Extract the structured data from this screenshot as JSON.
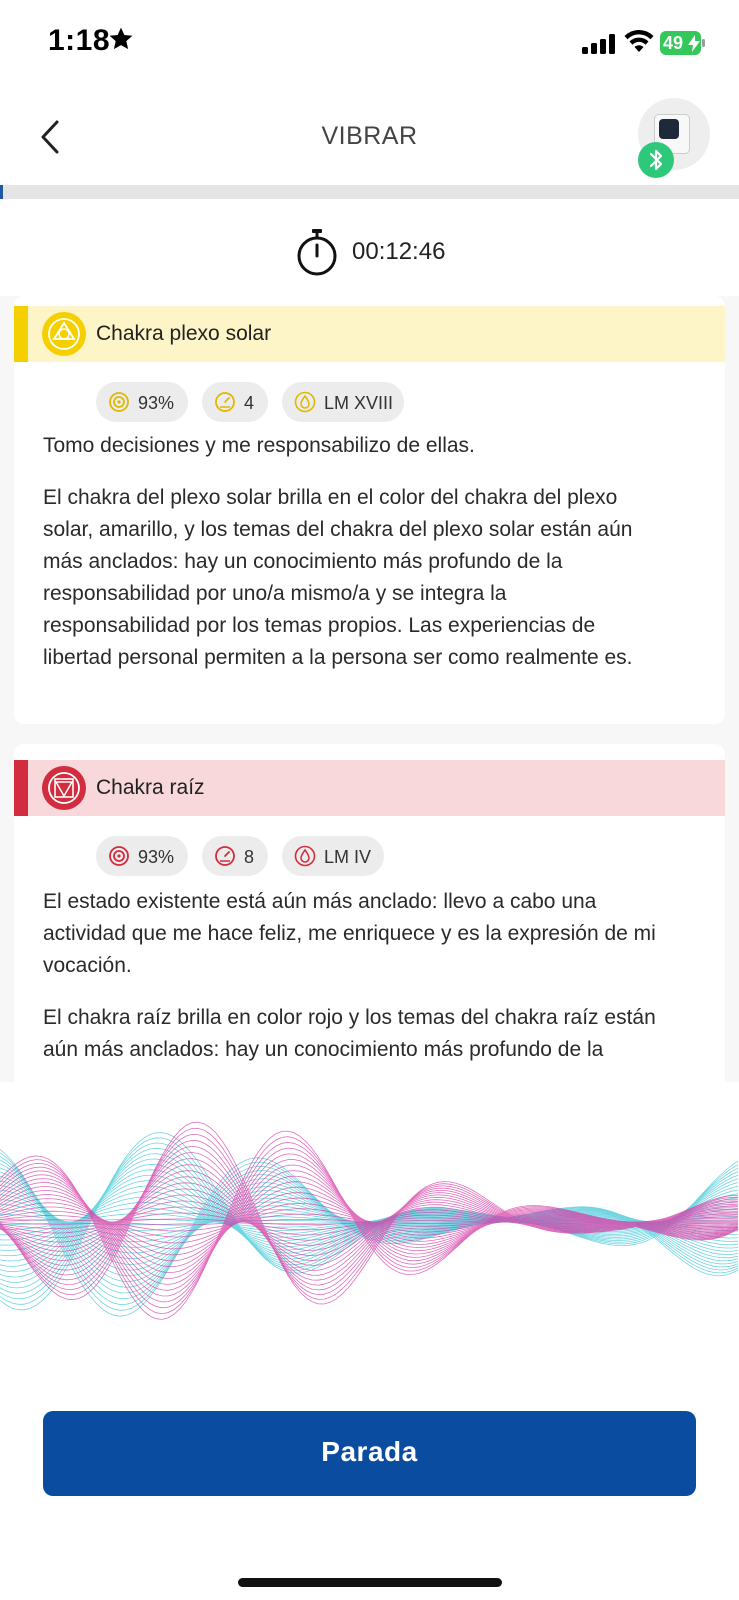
{
  "status_bar": {
    "time": "1:18",
    "battery": "49"
  },
  "header": {
    "title": "VIBRAR"
  },
  "timer": {
    "value": "00:12:46"
  },
  "cards": [
    {
      "name": "Chakra plexo solar",
      "accent": "#f5d000",
      "tint": "#fdf4c7",
      "stats": {
        "percent": "93%",
        "count": "4",
        "lm": "LM XVIII"
      },
      "intro": "Tomo decisiones y me responsabilizo de ellas.",
      "body": [
        "El chakra del plexo solar brilla en el color del chakra del plexo",
        "solar, amarillo, y los temas del chakra del plexo solar están aún",
        "más anclados: hay un conocimiento más profundo de la",
        "responsabilidad por uno/a mismo/a y se integra la",
        "responsabilidad por los temas propios. Las experiencias de",
        "libertad personal permiten a la persona ser como realmente es."
      ]
    },
    {
      "name": "Chakra raíz",
      "accent": "#d22d3f",
      "tint": "#f8d8da",
      "stats": {
        "percent": "93%",
        "count": "8",
        "lm": "LM IV"
      },
      "intro": [
        "El estado existente está aún más anclado: llevo a cabo una",
        "actividad que me hace feliz, me enriquece y es la expresión de mi",
        "vocación."
      ],
      "body": [
        "El chakra raíz brilla en color rojo y los temas del chakra raíz están",
        "aún más anclados: hay un conocimiento más profundo de la"
      ]
    }
  ],
  "stop_button": {
    "label": "Parada"
  },
  "colors": {
    "primary": "#0a4ca0",
    "wave_pink": "#d63fa8",
    "wave_cyan": "#3fc7d8",
    "bluetooth": "#2ec87a"
  }
}
